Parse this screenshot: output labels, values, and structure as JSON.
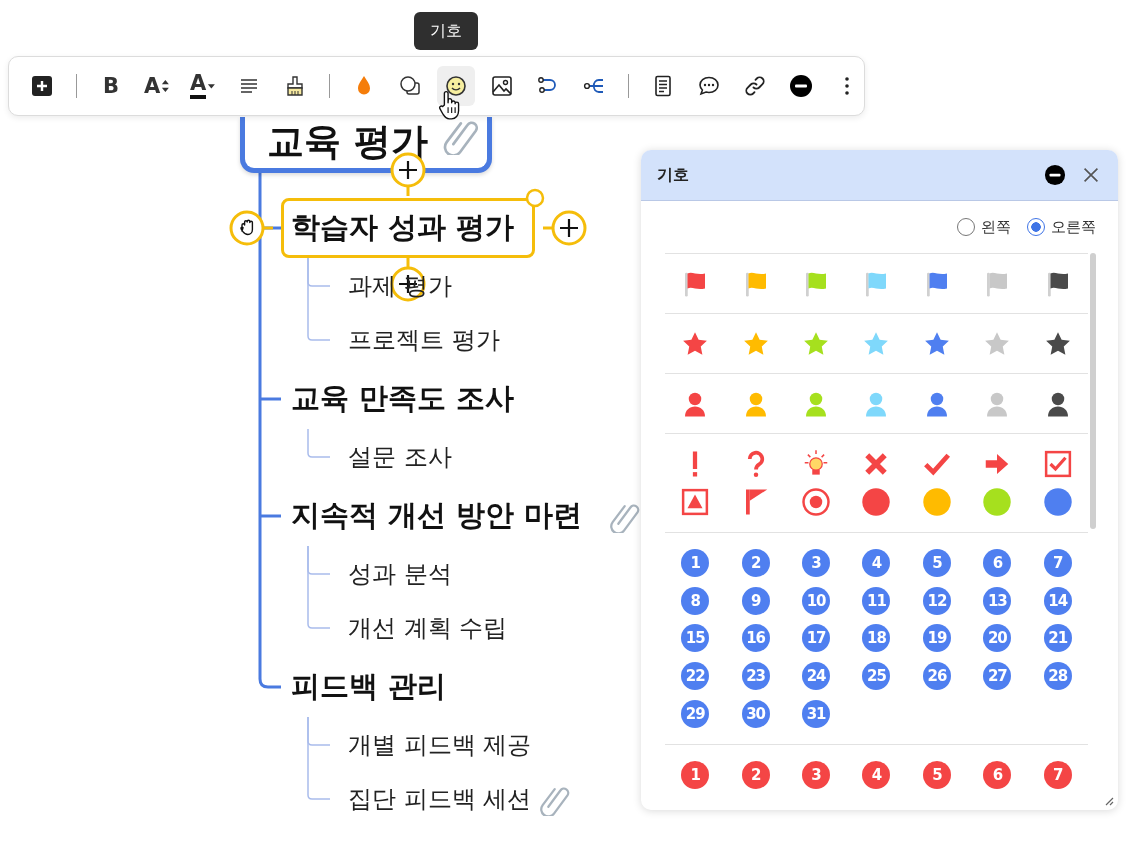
{
  "tooltip": "기호",
  "toolbar": [
    {
      "kind": "insert",
      "selected": false
    },
    {
      "kind": "separator"
    },
    {
      "kind": "bold",
      "label": "B",
      "selected": false
    },
    {
      "kind": "font-size",
      "label": "A",
      "selected": false
    },
    {
      "kind": "font-color",
      "label": "A",
      "selected": false
    },
    {
      "kind": "align",
      "selected": false
    },
    {
      "kind": "painter",
      "selected": false
    },
    {
      "kind": "separator"
    },
    {
      "kind": "fill",
      "selected": false
    },
    {
      "kind": "shape",
      "selected": false
    },
    {
      "kind": "emoji",
      "selected": true
    },
    {
      "kind": "image",
      "selected": false
    },
    {
      "kind": "relation",
      "selected": false
    },
    {
      "kind": "fork",
      "selected": false
    },
    {
      "kind": "separator"
    },
    {
      "kind": "note",
      "selected": false
    },
    {
      "kind": "comment",
      "selected": false
    },
    {
      "kind": "link",
      "selected": false
    },
    {
      "kind": "remove",
      "selected": false
    },
    {
      "kind": "more",
      "selected": false
    }
  ],
  "mindmap": {
    "root": {
      "text": "교육 평가",
      "attachment": true
    },
    "topics": [
      {
        "text": "학습자 성과 평가",
        "selected": true,
        "attachment": false,
        "children": [
          {
            "text": "과제 평가",
            "attachment": false
          },
          {
            "text": "프로젝트 평가",
            "attachment": false
          }
        ]
      },
      {
        "text": "교육 만족도 조사",
        "selected": false,
        "attachment": false,
        "children": [
          {
            "text": "설문 조사",
            "attachment": false
          }
        ]
      },
      {
        "text": "지속적 개선 방안 마련",
        "selected": false,
        "attachment": true,
        "children": [
          {
            "text": "성과 분석",
            "attachment": false
          },
          {
            "text": "개선 계획 수립",
            "attachment": false
          }
        ]
      },
      {
        "text": "피드백 관리",
        "selected": false,
        "attachment": false,
        "children": [
          {
            "text": "개별 피드백 제공",
            "attachment": false
          },
          {
            "text": "집단 피드백 세션",
            "attachment": true
          }
        ]
      }
    ]
  },
  "panel": {
    "title": "기호",
    "positions": [
      {
        "label": "왼쪽",
        "selected": false
      },
      {
        "label": "오른쪽",
        "selected": true
      }
    ],
    "groups": [
      {
        "kind": "flag",
        "items": [
          {
            "color": "#f44545"
          },
          {
            "color": "#ffbb00"
          },
          {
            "color": "#a6e01e"
          },
          {
            "color": "#7fd8fb"
          },
          {
            "color": "#4f7ff0"
          },
          {
            "color": "#c8c8c8"
          },
          {
            "color": "#4a4a4a"
          }
        ]
      },
      {
        "kind": "star",
        "items": [
          {
            "color": "#f44545"
          },
          {
            "color": "#ffbb00"
          },
          {
            "color": "#a6e01e"
          },
          {
            "color": "#7fd8fb"
          },
          {
            "color": "#4f7ff0"
          },
          {
            "color": "#c8c8c8"
          },
          {
            "color": "#4a4a4a"
          }
        ]
      },
      {
        "kind": "person",
        "items": [
          {
            "color": "#f44545"
          },
          {
            "color": "#ffbb00"
          },
          {
            "color": "#a6e01e"
          },
          {
            "color": "#7fd8fb"
          },
          {
            "color": "#4f7ff0"
          },
          {
            "color": "#c8c8c8"
          },
          {
            "color": "#4a4a4a"
          }
        ]
      },
      {
        "kind": "marker",
        "items": [
          {
            "kind": "exclamation"
          },
          {
            "kind": "question"
          },
          {
            "kind": "bulb"
          },
          {
            "kind": "cross"
          },
          {
            "kind": "check"
          },
          {
            "kind": "arrow"
          },
          {
            "kind": "checkbox"
          },
          {
            "kind": "triangle-box"
          },
          {
            "kind": "pennant"
          },
          {
            "kind": "target"
          },
          {
            "kind": "dot",
            "color": "#f44545"
          },
          {
            "kind": "dot",
            "color": "#ffbb00"
          },
          {
            "kind": "dot",
            "color": "#a6e01e"
          },
          {
            "kind": "dot",
            "color": "#4f7ff0"
          }
        ]
      },
      {
        "kind": "number",
        "color": "#4f7ff0",
        "items": [
          {
            "label": "1"
          },
          {
            "label": "2"
          },
          {
            "label": "3"
          },
          {
            "label": "4"
          },
          {
            "label": "5"
          },
          {
            "label": "6"
          },
          {
            "label": "7"
          },
          {
            "label": "8"
          },
          {
            "label": "9"
          },
          {
            "label": "10"
          },
          {
            "label": "11"
          },
          {
            "label": "12"
          },
          {
            "label": "13"
          },
          {
            "label": "14"
          },
          {
            "label": "15"
          },
          {
            "label": "16"
          },
          {
            "label": "17"
          },
          {
            "label": "18"
          },
          {
            "label": "19"
          },
          {
            "label": "20"
          },
          {
            "label": "21"
          },
          {
            "label": "22"
          },
          {
            "label": "23"
          },
          {
            "label": "24"
          },
          {
            "label": "25"
          },
          {
            "label": "26"
          },
          {
            "label": "27"
          },
          {
            "label": "28"
          },
          {
            "label": "29"
          },
          {
            "label": "30"
          },
          {
            "label": "31"
          }
        ]
      },
      {
        "kind": "number",
        "color": "#f44545",
        "items": [
          {
            "label": "1"
          },
          {
            "label": "2"
          },
          {
            "label": "3"
          },
          {
            "label": "4"
          },
          {
            "label": "5"
          },
          {
            "label": "6"
          },
          {
            "label": "7"
          }
        ]
      }
    ]
  }
}
